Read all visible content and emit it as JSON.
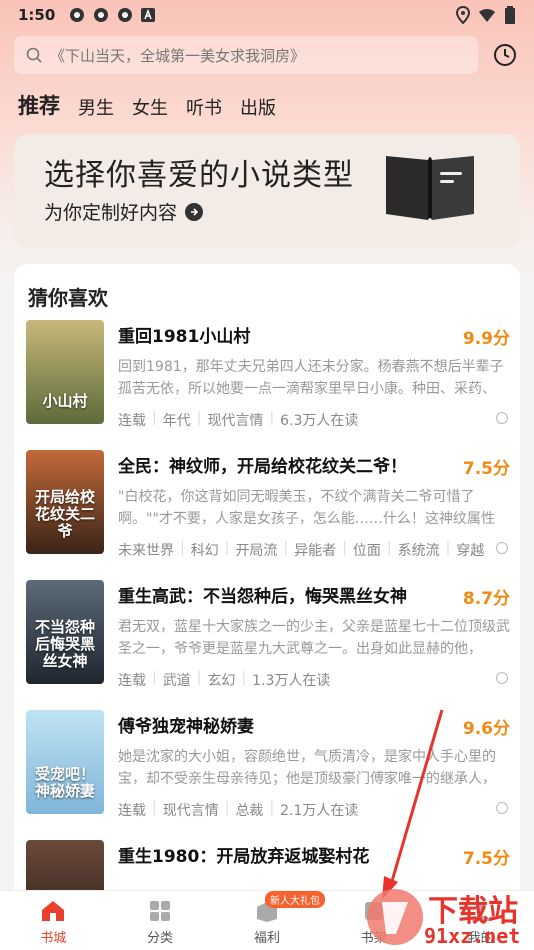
{
  "status": {
    "time": "1:50",
    "left_icons": [
      "app-icon",
      "app-icon",
      "app-icon",
      "a-icon"
    ],
    "right_icons": [
      "location-icon",
      "wifi-icon",
      "battery-icon"
    ]
  },
  "search": {
    "placeholder": "《下山当天，全城第一美女求我洞房》"
  },
  "tabs": [
    {
      "label": "推荐",
      "active": true
    },
    {
      "label": "男生"
    },
    {
      "label": "女生"
    },
    {
      "label": "听书"
    },
    {
      "label": "出版"
    }
  ],
  "banner": {
    "title": "选择你喜爱的小说类型",
    "subtitle": "为你定制好内容"
  },
  "section": {
    "title": "猜你喜欢"
  },
  "books": [
    {
      "title": "重回1981小山村",
      "score": "9.9分",
      "desc": "回到1981，那年丈夫兄弟四人还未分家。杨春燕不想后半辈子孤苦无依，所以她要一点一滴帮家里早日小康。种田、采药、",
      "tags": [
        "连载",
        "年代",
        "现代言情",
        "6.3万人在读"
      ],
      "cover_text": "小山村",
      "cover_colors": [
        "#c8b77a",
        "#5d6b3a"
      ]
    },
    {
      "title": "全民：神纹师，开局给校花纹关二爷！",
      "score": "7.5分",
      "desc": "\"白校花，你这背如同无暇美玉，不纹个满背关二爷可惜了啊。\"\"才不要，人家是女孩子，怎么能……什么！这神纹属性",
      "tags": [
        "未来世界",
        "科幻",
        "开局流",
        "异能者",
        "位面",
        "系统流",
        "穿越"
      ],
      "cover_text": "开局给校花纹关二爷",
      "cover_colors": [
        "#c46a3a",
        "#3a2418"
      ]
    },
    {
      "title": "重生高武：不当怨种后，悔哭黑丝女神",
      "score": "8.7分",
      "desc": "君无双，蓝星十大家族之一的少主，父亲是蓝星七十二位顶级武圣之一，爷爷更是蓝星九大武尊之一。出身如此显赫的他，",
      "tags": [
        "连载",
        "武道",
        "玄幻",
        "1.3万人在读"
      ],
      "cover_text": "不当怨种后悔哭黑丝女神",
      "cover_colors": [
        "#5c6a78",
        "#1f2630"
      ]
    },
    {
      "title": "傅爷独宠神秘娇妻",
      "score": "9.6分",
      "desc": "她是沈家的大小姐，容颜绝世，气质清冷，是家中人手心里的宝，却不受亲生母亲待见；他是顶级豪门傅家唯一的继承人，",
      "tags": [
        "连载",
        "现代言情",
        "总裁",
        "2.1万人在读"
      ],
      "cover_text": "受宠吧！神秘娇妻",
      "cover_colors": [
        "#bfe3f2",
        "#7fb5d9"
      ]
    },
    {
      "title": "重生1980：开局放弃返城娶村花",
      "score": "7.5分",
      "desc": "",
      "tags": [],
      "cover_text": "",
      "cover_colors": [
        "#6a4a3a",
        "#2a1c16"
      ]
    }
  ],
  "bottom_nav": [
    {
      "label": "书城",
      "icon": "home-icon",
      "active": true
    },
    {
      "label": "分类",
      "icon": "grid-icon"
    },
    {
      "label": "福利",
      "icon": "gift-icon",
      "badge": "新人大礼包"
    },
    {
      "label": "书架",
      "icon": "bookshelf-icon"
    },
    {
      "label": "我的",
      "icon": "profile-icon"
    }
  ],
  "watermark": {
    "text": "下载站",
    "domain": "91xz.net"
  },
  "colors": {
    "accent": "#e8412d",
    "score": "#f08a12"
  }
}
